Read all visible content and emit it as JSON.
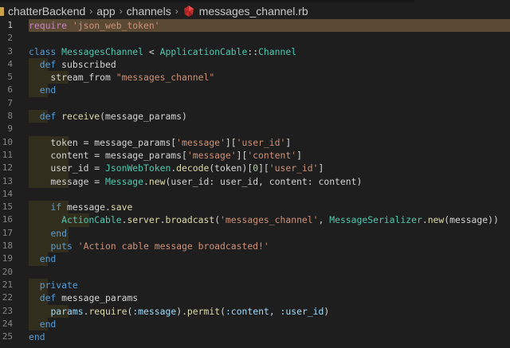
{
  "breadcrumb": {
    "segments": [
      "chatterBackend",
      "app",
      "channels",
      "messages_channel.rb"
    ],
    "separator": "›"
  },
  "colors": {
    "background": "#1e1e1e",
    "active_line": "#5a4a34",
    "keyword": "#c586c0",
    "string": "#ce9178",
    "class": "#4ec9b0",
    "function": "#dcdcaa",
    "variable": "#9cdcfe"
  },
  "editor": {
    "active_line": 1,
    "file_language": "ruby",
    "lines": [
      {
        "n": "1",
        "text": "require 'json_web_token'"
      },
      {
        "n": "2",
        "text": ""
      },
      {
        "n": "3",
        "text": "class MessagesChannel < ApplicationCable::Channel"
      },
      {
        "n": "4",
        "text": "  def subscribed"
      },
      {
        "n": "5",
        "text": "    stream_from \"messages_channel\""
      },
      {
        "n": "6",
        "text": "  end"
      },
      {
        "n": "7",
        "text": ""
      },
      {
        "n": "8",
        "text": "  def receive(message_params)"
      },
      {
        "n": "9",
        "text": ""
      },
      {
        "n": "10",
        "text": "    token = message_params['message']['user_id']"
      },
      {
        "n": "11",
        "text": "    content = message_params['message']['content']"
      },
      {
        "n": "12",
        "text": "    user_id = JsonWebToken.decode(token)[0]['user_id']"
      },
      {
        "n": "13",
        "text": "    message = Message.new(user_id: user_id, content: content)"
      },
      {
        "n": "14",
        "text": ""
      },
      {
        "n": "15",
        "text": "    if message.save"
      },
      {
        "n": "16",
        "text": "      ActionCable.server.broadcast('messages_channel', MessageSerializer.new(message))"
      },
      {
        "n": "17",
        "text": "    end"
      },
      {
        "n": "18",
        "text": "    puts 'Action cable message broadcasted!'"
      },
      {
        "n": "19",
        "text": "  end"
      },
      {
        "n": "20",
        "text": ""
      },
      {
        "n": "21",
        "text": "  private"
      },
      {
        "n": "22",
        "text": "  def message_params"
      },
      {
        "n": "23",
        "text": "    params.require(:message).permit(:content, :user_id)"
      },
      {
        "n": "24",
        "text": "  end"
      },
      {
        "n": "25",
        "text": "end"
      }
    ]
  }
}
